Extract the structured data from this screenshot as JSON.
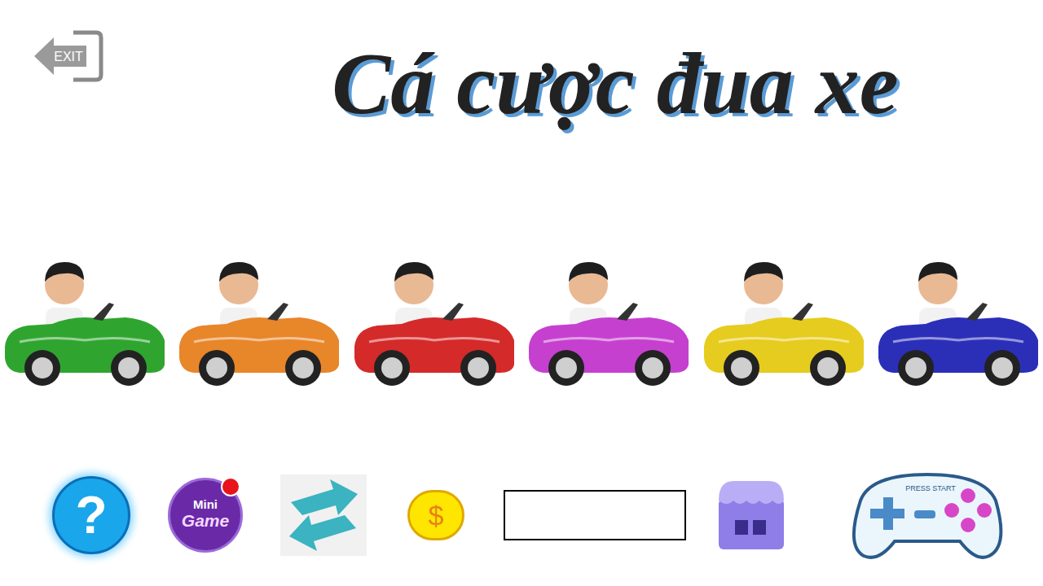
{
  "exit": {
    "label": "EXIT"
  },
  "title": "Cá cược đua xe",
  "cars": [
    {
      "color": "#2fa52f"
    },
    {
      "color": "#e8862a"
    },
    {
      "color": "#d42a2a"
    },
    {
      "color": "#c640d0"
    },
    {
      "color": "#e6cc1e"
    },
    {
      "color": "#2b2fb8"
    }
  ],
  "toolbar": {
    "help": "?",
    "minigame": {
      "label_top": "Mini",
      "label_bottom": "Game",
      "badge": true
    },
    "coin": "$",
    "bet": {
      "value": ""
    },
    "controller": "PRESS START"
  }
}
